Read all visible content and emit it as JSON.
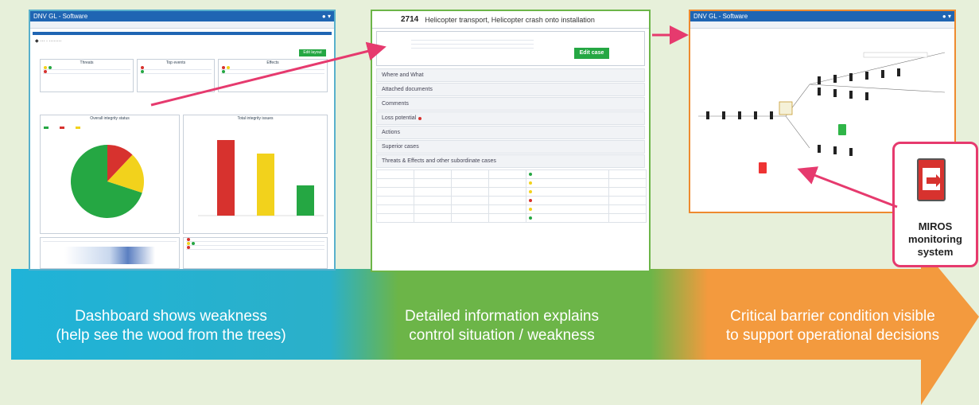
{
  "colors": {
    "background": "#e7f0da",
    "band_blue": "#1fb3d8",
    "band_green": "#6cb548",
    "band_orange": "#f39a3e",
    "pointer_pink": "#e63a6e"
  },
  "captions": [
    {
      "line1": "Dashboard shows weakness",
      "line2": "(help see the wood from the trees)"
    },
    {
      "line1": "Detailed information explains",
      "line2": "control situation / weakness"
    },
    {
      "line1": "Critical barrier condition visible",
      "line2": "to support operational decisions"
    }
  ],
  "dashboard": {
    "app_title": "DNV GL - Software",
    "sections": [
      "Threats",
      "Top events",
      "Effects"
    ],
    "button": "Edit layout",
    "pie_title": "Overall integrity status",
    "bar_title": "Total integrity issues",
    "pie_values": {
      "green": 0.7,
      "yellow": 0.18,
      "red": 0.12
    },
    "bar_values": [
      0.95,
      0.78,
      0.38
    ],
    "bar_colors": [
      "#d7322e",
      "#f2d21c",
      "#25a743"
    ]
  },
  "case": {
    "number": "2714",
    "title": "Helicopter transport, Helicopter crash onto installation",
    "edit_button": "Edit case",
    "sections": [
      "Where and What",
      "Attached documents",
      "Comments",
      "Loss potential",
      "Actions",
      "Superior cases",
      "Threats & Effects and other subordinate cases"
    ],
    "status_dots": [
      "#25a743",
      "#f2d21c",
      "#f2d21c",
      "#d7322e",
      "#f2d21c",
      "#25a743"
    ]
  },
  "diagram": {
    "app_title": "DNV GL - Software"
  },
  "miros": {
    "line1": "MIROS",
    "line2": "monitoring",
    "line3": "system"
  }
}
